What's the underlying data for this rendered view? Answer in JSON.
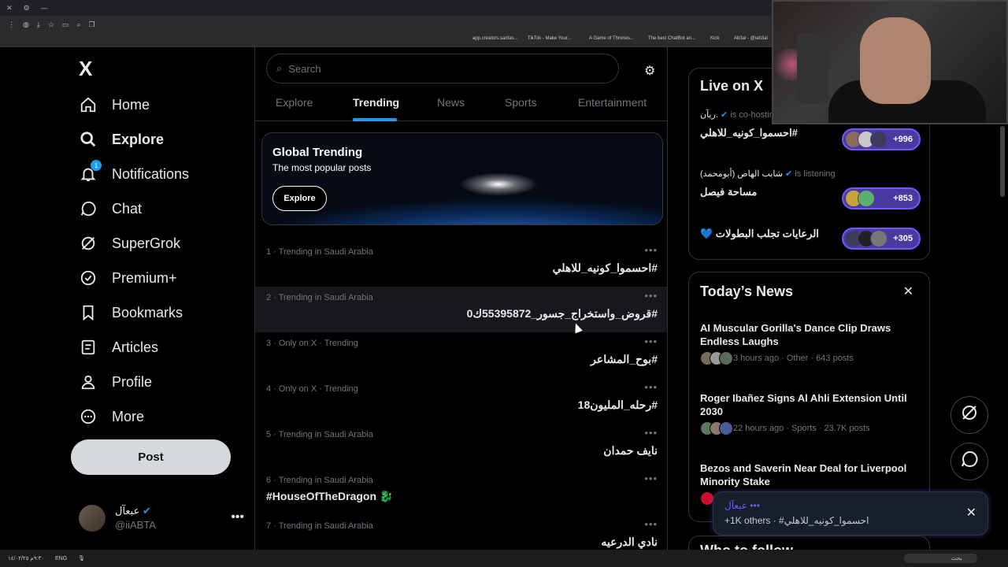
{
  "browser": {
    "bookmarks": [
      {
        "label": "app.creators.sa/das..."
      },
      {
        "label": "TikTok - Make Your..."
      },
      {
        "label": "A Game of Thrones..."
      },
      {
        "label": "The best ChatBot an..."
      },
      {
        "label": "Kick"
      },
      {
        "label": "Ab3al - @iab3al"
      }
    ]
  },
  "sidebar": {
    "logo": "X",
    "items": [
      {
        "label": "Home",
        "icon": "home-icon"
      },
      {
        "label": "Explore",
        "icon": "search-icon"
      },
      {
        "label": "Notifications",
        "icon": "bell-icon",
        "badge": "1"
      },
      {
        "label": "Chat",
        "icon": "chat-icon"
      },
      {
        "label": "SuperGrok",
        "icon": "grok-icon"
      },
      {
        "label": "Premium+",
        "icon": "premium-icon"
      },
      {
        "label": "Bookmarks",
        "icon": "bookmark-icon"
      },
      {
        "label": "Articles",
        "icon": "articles-icon"
      },
      {
        "label": "Profile",
        "icon": "person-icon"
      },
      {
        "label": "More",
        "icon": "more-circle-icon"
      }
    ],
    "post_label": "Post",
    "account": {
      "name": "عبعآل",
      "handle": "@iiABTA"
    }
  },
  "center": {
    "search_placeholder": "Search",
    "tabs": [
      "Explore",
      "Trending",
      "News",
      "Sports",
      "Entertainment"
    ],
    "active_tab": "Trending",
    "banner": {
      "title": "Global Trending",
      "subtitle": "The most popular posts",
      "button": "Explore"
    },
    "trends": [
      {
        "meta": "1 · Trending in Saudi Arabia",
        "topic": "#احسموا_كونيه_للاهلي"
      },
      {
        "meta": "2 · Trending in Saudi Arabia",
        "topic": "#قروض_واستخراج_جسور_55395872ك0"
      },
      {
        "meta": "3 · Only on X · Trending",
        "topic": "#بوح_المشاعر"
      },
      {
        "meta": "4 · Only on X · Trending",
        "topic": "#رحله_المليون18"
      },
      {
        "meta": "5 · Trending in Saudi Arabia",
        "topic": "نايف حمدان"
      },
      {
        "meta": "6 · Trending in Saudi Arabia",
        "topic": "#HouseOfTheDragon 🐉"
      },
      {
        "meta": "7 · Trending in Saudi Arabia",
        "topic": "نادي الدرعيه"
      }
    ]
  },
  "live": {
    "title": "Live on X",
    "spaces": [
      {
        "host": "ريآن.",
        "status": "is co-hosting",
        "name": "#احسموا_كونيه_للاهلي",
        "count": "+996",
        "colors": [
          "#8a6a5a",
          "#c9c9c9",
          "#3b3b5a"
        ]
      },
      {
        "host": "شايب الهاص (أبومحمد)",
        "status": "is listening",
        "name": "مساحة فيصل",
        "count": "+853",
        "colors": [
          "#c9a23a",
          "#5bb06b"
        ]
      },
      {
        "host": "",
        "status": "",
        "name": "الرعايات تجلب البطولات 💙",
        "count": "+305",
        "colors": [
          "#3b3b5a",
          "#222",
          "#777"
        ]
      }
    ]
  },
  "news": {
    "title": "Today’s News",
    "stories": [
      {
        "headline": "AI Muscular Gorilla's Dance Clip Draws Endless Laughs",
        "meta": "3 hours ago · Other · 643 posts",
        "colors": [
          "#7a6a5a",
          "#9a9a9a",
          "#5a6a5a"
        ]
      },
      {
        "headline": "Roger Ibañez Signs Al Ahli Extension Until 2030",
        "meta": "22 hours ago · Sports · 23.7K posts",
        "colors": [
          "#5a7a5a",
          "#8a7a6a",
          "#4a5a9a"
        ]
      },
      {
        "headline": "Bezos and Saverin Near Deal for Liverpool Minority Stake",
        "meta": "",
        "colors": [
          "#c8102e"
        ]
      }
    ]
  },
  "toast": {
    "line1": "عبعآل •••",
    "line2": "+1K others · #احسموا_كونيه_للاهلي"
  },
  "follow_title": "Who to follow",
  "taskbar": {
    "time": "٩:٣٠م",
    "date": "١٤/٠٢/٢٥",
    "lang": "ENG",
    "search": "بحث"
  },
  "colors": {
    "accent": "#1d9bf0",
    "spaces_purple": "#7856ff",
    "background": "#000000"
  }
}
